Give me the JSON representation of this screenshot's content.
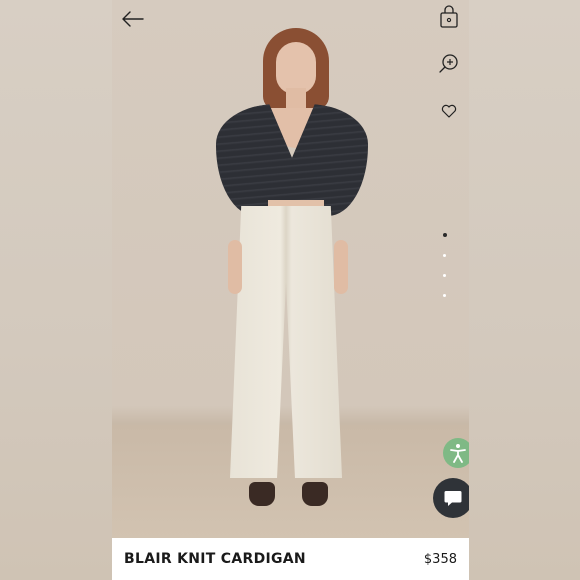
{
  "product": {
    "name": "BLAIR KNIT CARDIGAN",
    "price": "$358"
  },
  "icons": {
    "back": "arrow-left-icon",
    "bag": "shopping-bag-icon",
    "zoom": "zoom-in-icon",
    "wishlist": "heart-icon",
    "accessibility": "accessibility-icon",
    "chat": "chat-icon"
  },
  "carousel": {
    "total": 4,
    "active_index": 0
  },
  "colors": {
    "accessibility_bg": "#7fb985",
    "chat_bg": "#2f3338",
    "product_bar_bg": "#ffffff"
  }
}
